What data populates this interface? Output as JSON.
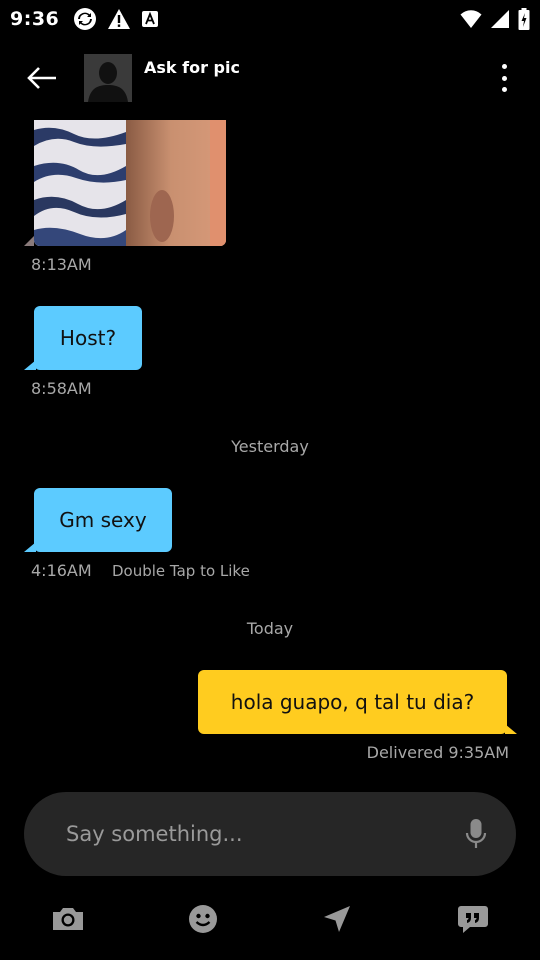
{
  "status_bar": {
    "time": "9:36"
  },
  "header": {
    "title": "Ask for pic"
  },
  "messages": {
    "photo_time": "8:13AM",
    "host_text": "Host?",
    "host_time": "8:58AM",
    "divider_yesterday": "Yesterday",
    "gm_text": "Gm sexy",
    "gm_time": "4:16AM",
    "gm_hint": "Double Tap to Like",
    "divider_today": "Today",
    "outgoing_text": "hola guapo, q tal tu dia?",
    "outgoing_status": "Delivered 9:35AM"
  },
  "composer": {
    "placeholder": "Say something..."
  },
  "toolbar": {
    "items": [
      "camera-icon",
      "emoji-icon",
      "location-icon",
      "phrases-icon"
    ]
  },
  "colors": {
    "incoming": "#5ccbff",
    "outgoing": "#ffcc1f",
    "background": "#000000",
    "composer": "#262626"
  }
}
